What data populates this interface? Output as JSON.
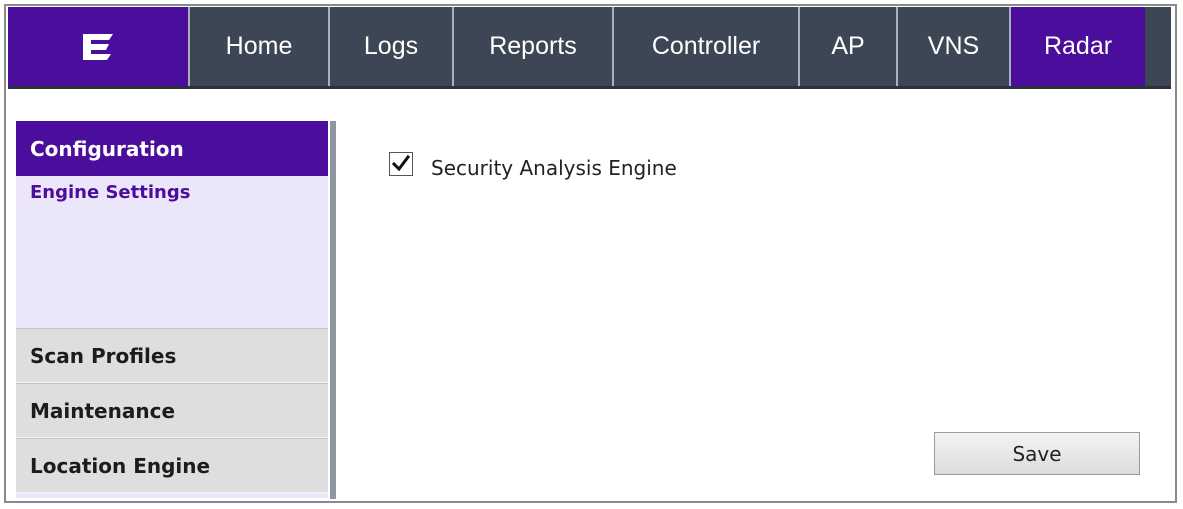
{
  "header": {
    "logo_icon": "extreme-networks-logo-icon",
    "nav": [
      {
        "label": "Home"
      },
      {
        "label": "Logs"
      },
      {
        "label": "Reports"
      },
      {
        "label": "Controller"
      },
      {
        "label": "AP"
      },
      {
        "label": "VNS"
      },
      {
        "label": "Radar",
        "active": true
      }
    ]
  },
  "sidebar": {
    "active_section": "Configuration",
    "active_subitem": "Engine Settings",
    "items": [
      {
        "label": "Scan Profiles"
      },
      {
        "label": "Maintenance"
      },
      {
        "label": "Location Engine"
      }
    ]
  },
  "main": {
    "security_engine": {
      "label": "Security Analysis Engine",
      "checked": true
    },
    "save_label": "Save"
  },
  "colors": {
    "brand_purple": "#4b0d9b",
    "nav_bg": "#3d4654",
    "sidebar_bg": "#ece6fb",
    "sidebar_item_bg": "#dedede"
  }
}
